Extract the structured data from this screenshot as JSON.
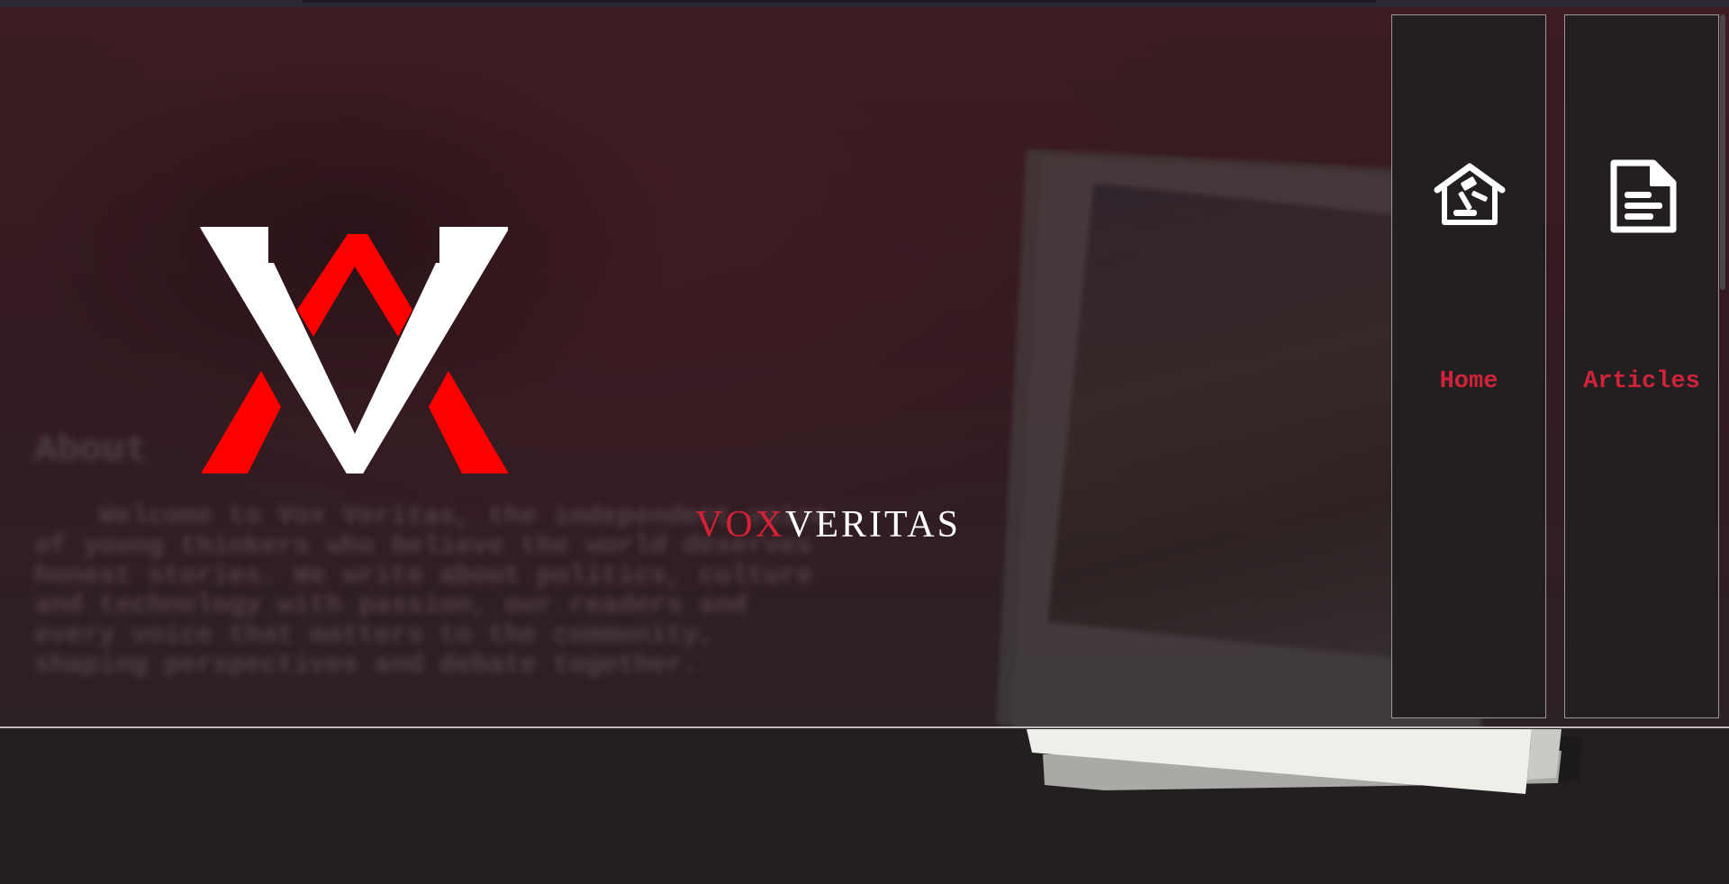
{
  "brand": {
    "name_part1": "VOX",
    "name_part2": "VERITAS",
    "accent_color": "#d32237",
    "text_color": "#ffffff"
  },
  "background": {
    "about_heading": "About",
    "about_text": "Welcome to Vox Veritas, the independent voice of young thinkers who believe the world deserves honest stories. We write about politics, culture and technology with passion, our readers and every voice that matters to the community, shaping perspectives and debate together."
  },
  "nav": {
    "items": [
      {
        "label": "Home",
        "icon": "house-gavel-icon"
      },
      {
        "label": "Articles",
        "icon": "document-icon"
      }
    ]
  },
  "colors": {
    "page_bg": "#231f21",
    "nav_label": "#cf2339",
    "panel_border": "#9b9799"
  }
}
